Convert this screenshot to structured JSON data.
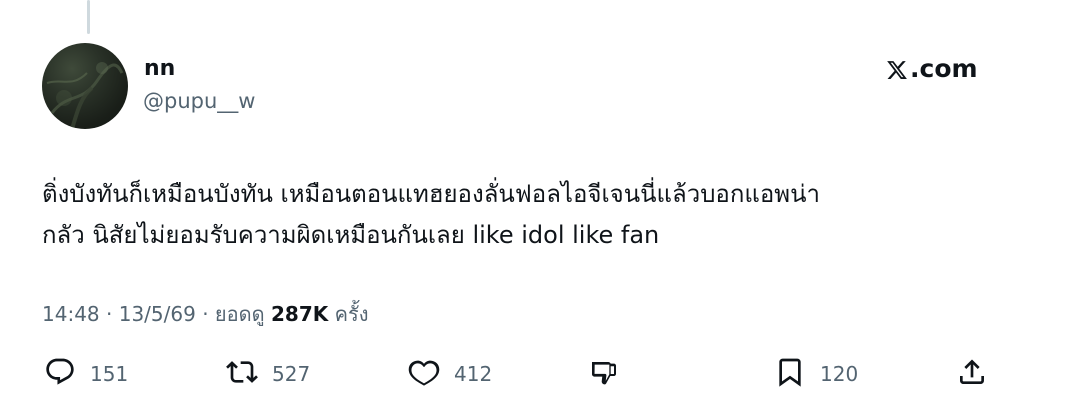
{
  "author": {
    "display_name": "nn",
    "handle": "@pupu__w"
  },
  "source_label": ".com",
  "tweet": {
    "lines": [
      "ติ่งบังทันก็เหมือนบังทัน เหมือนตอนแทฮยองลั่นฟอลไอจีเจนนี่แล้วบอกแอพน่า",
      "กลัว นิสัยไม่ยอมรับความผิดเหมือนกันเลย like idol like fan"
    ]
  },
  "meta": {
    "time": "14:48",
    "date": "13/5/69",
    "views_label": "ยอดดู",
    "views_count": "287K",
    "views_suffix": "ครั้ง",
    "separator": "·"
  },
  "actions": {
    "reply_count": "151",
    "retweet_count": "527",
    "like_count": "412",
    "bookmark_count": "120"
  },
  "icons": {
    "brand": "x-logo-icon",
    "reply": "reply-icon",
    "retweet": "retweet-icon",
    "like": "heart-icon",
    "dislike": "thumbs-down-icon",
    "bookmark": "bookmark-icon",
    "share": "share-icon"
  },
  "colors": {
    "text_primary": "#0f1419",
    "text_secondary": "#536471",
    "thread_line": "#cfd9de"
  }
}
